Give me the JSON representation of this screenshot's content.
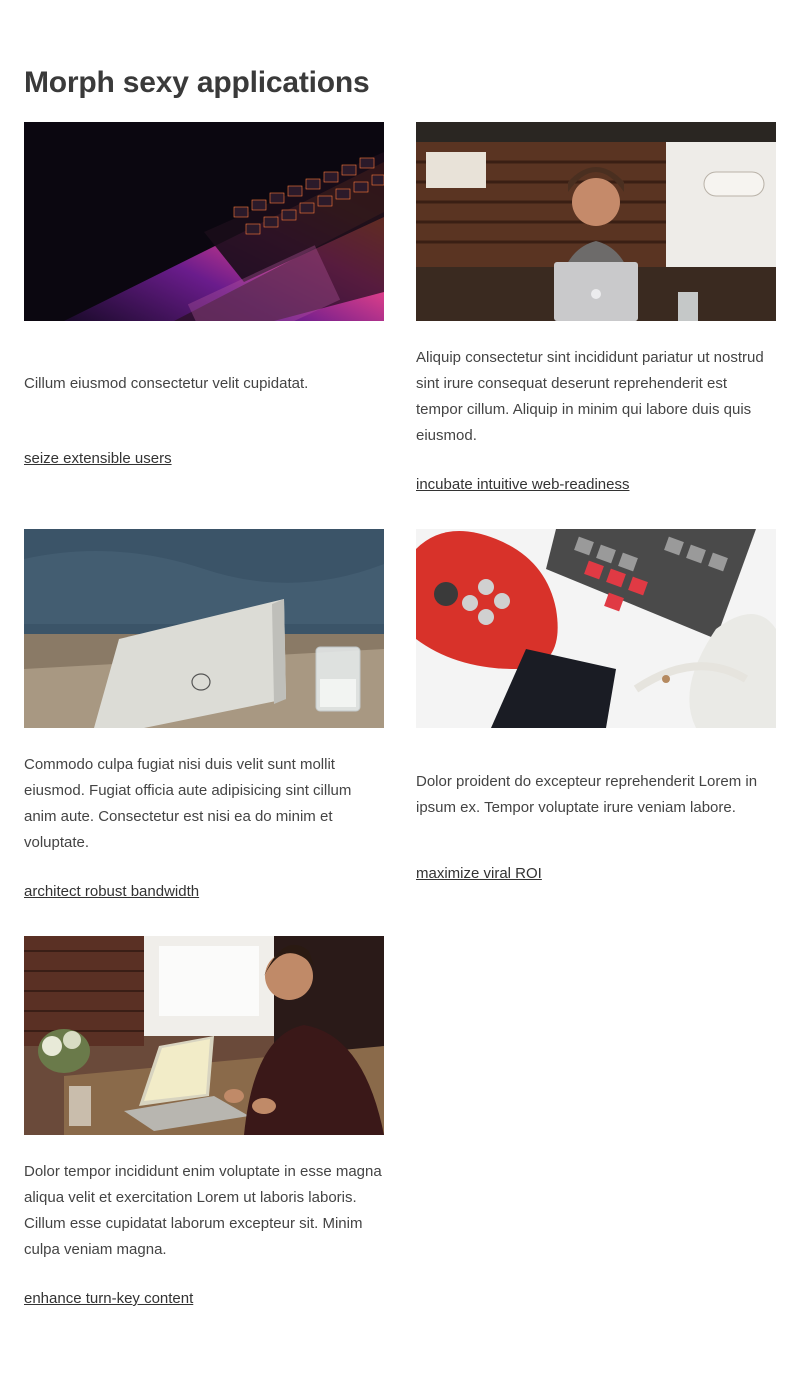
{
  "page": {
    "title": "Morph sexy applications"
  },
  "cards": [
    {
      "image": "laptop-keyboard-rgb-photo",
      "text": "Cillum eiusmod consectetur velit cupidatat.",
      "link": "seize extensible users"
    },
    {
      "image": "man-smiling-with-laptop-in-cafe-photo",
      "text": "Aliquip consectetur sint incididunt pariatur ut nostrud sint irure consequat deserunt reprehenderit est tempor cillum. Aliquip in minim qui labore duis quis eiusmod.",
      "link": "incubate intuitive web-readiness"
    },
    {
      "image": "laptop-on-table-with-glass-photo",
      "text": "Commodo culpa fugiat nisi duis velit sunt mollit eiusmod. Fugiat officia aute adipisicing sint cillum anim aute. Consectetur est nisi ea do minim et voluptate.",
      "link": "architect robust bandwidth"
    },
    {
      "image": "gamepad-keyboard-phone-headphones-photo",
      "text": "Dolor proident do excepteur reprehenderit Lorem in ipsum ex. Tempor voluptate irure veniam labore.",
      "link": "maximize viral ROI"
    },
    {
      "image": "man-working-on-laptop-at-desk-photo",
      "text": "Dolor tempor incididunt enim voluptate in esse magna aliqua velit et exercitation Lorem ut laboris laboris. Cillum esse cupidatat laborum excepteur sit. Minim culpa veniam magna.",
      "link": "enhance turn-key content"
    }
  ]
}
